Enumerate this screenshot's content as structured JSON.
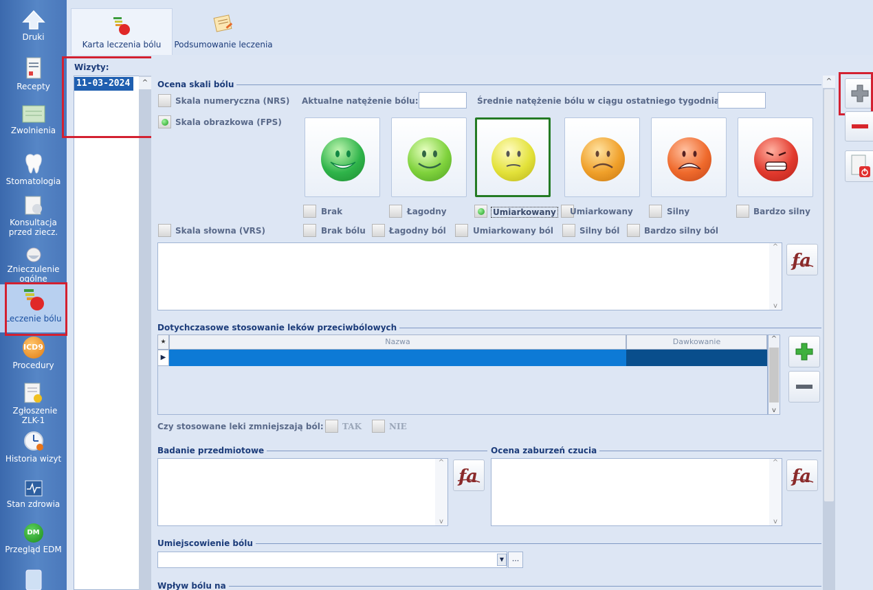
{
  "nav": {
    "items": [
      {
        "id": "druki",
        "label": "Druki"
      },
      {
        "id": "recepty",
        "label": "Recepty"
      },
      {
        "id": "zwolnienia",
        "label": "Zwolnienia"
      },
      {
        "id": "stomatologia",
        "label": "Stomatologia"
      },
      {
        "id": "konsultacja",
        "label": "Konsultacja przed ziecz."
      },
      {
        "id": "znieczulenie",
        "label": "Znieczulenie ogólne"
      },
      {
        "id": "leczenie",
        "label": "Leczenie bólu"
      },
      {
        "id": "procedury",
        "label": "Procedury",
        "badge": "ICD9"
      },
      {
        "id": "zgloszenie",
        "label": "Zgłoszenie ZLK-1"
      },
      {
        "id": "historia",
        "label": "Historia wizyt"
      },
      {
        "id": "stan",
        "label": "Stan zdrowia"
      },
      {
        "id": "edm",
        "label": "Przegląd EDM",
        "badge": "DM"
      }
    ]
  },
  "tabs": [
    {
      "label": "Karta leczenia bólu"
    },
    {
      "label": "Podsumowanie leczenia"
    }
  ],
  "visits": {
    "label": "Wizyty:",
    "items": [
      "11-03-2024"
    ]
  },
  "pain_scale": {
    "title": "Ocena skali bólu",
    "nrs_label": "Skala numeryczna (NRS)",
    "current_label": "Aktualne natężenie bólu:",
    "current_value": "",
    "avg_label": "Średnie natężenie bólu w ciągu ostatniego tygodnia:",
    "avg_value": "",
    "fps_label": "Skala obrazkowa (FPS)",
    "fps_options": [
      "Brak",
      "Łagodny",
      "Umiarkowany",
      "Umiarkowany",
      "Silny",
      "Bardzo silny"
    ],
    "fps_selected_index": 2,
    "face_colors": [
      "#2fb44a",
      "#7fd23c",
      "#e3e23a",
      "#f0a02a",
      "#ef6a2c",
      "#e23a2e"
    ],
    "vrs_label": "Skala słowna (VRS)",
    "vrs_options": [
      "Brak bólu",
      "Łagodny ból",
      "Umiarkowany ból",
      "Silny ból",
      "Bardzo silny ból"
    ],
    "notes": ""
  },
  "meds": {
    "title": "Dotychczasowe stosowanie leków przeciwbólowych",
    "columns": [
      "Nazwa",
      "Dawkowanie"
    ],
    "question": "Czy stosowane leki zmniejszają ból:",
    "yes_label": "TAK",
    "no_label": "NIE"
  },
  "exam": {
    "title": "Badanie przedmiotowe",
    "value": ""
  },
  "sensory": {
    "title": "Ocena zaburzeń czucia",
    "value": ""
  },
  "location": {
    "title": "Umiejscowienie bólu",
    "value": "",
    "more_label": "..."
  },
  "impact": {
    "title": "Wpływ bólu na"
  }
}
